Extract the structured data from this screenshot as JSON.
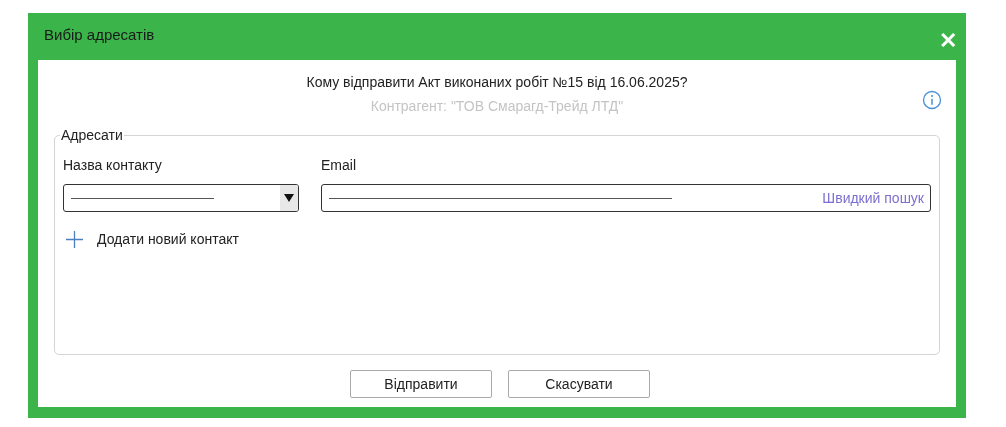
{
  "window": {
    "title": "Вибір адресатів",
    "close": "✕"
  },
  "question": "Кому відправити Акт виконаних робіт №15 від 16.06.2025?",
  "counterparty": "Контрагент: \"ТОВ Смарагд-Трейд ЛТД\"",
  "recipients": {
    "legend": "Адресати",
    "contact_label": "Назва контакту",
    "email_label": "Email",
    "quick_search": "Швидкий пошук",
    "add_contact": "Додати новий контакт"
  },
  "buttons": [
    "Відправити",
    "Скасувати"
  ]
}
